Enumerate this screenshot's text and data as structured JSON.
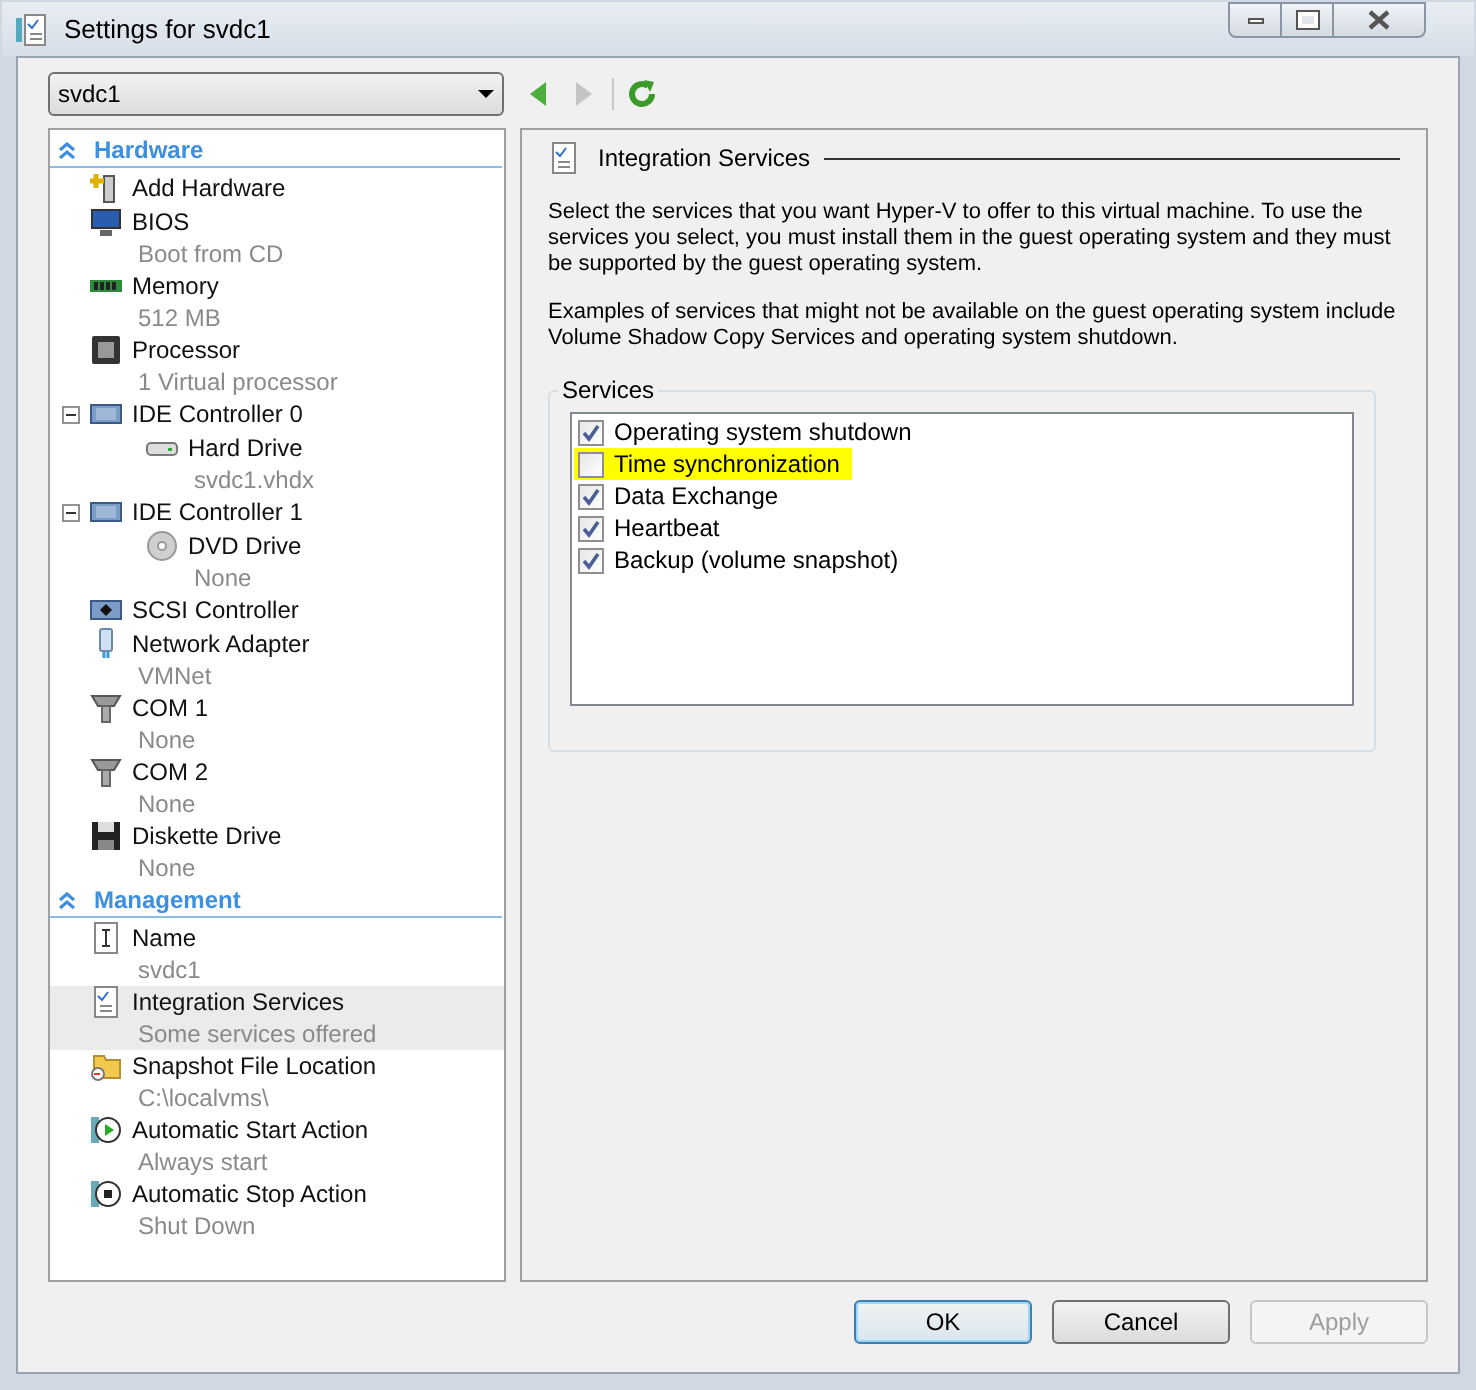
{
  "window": {
    "title": "Settings for svdc1"
  },
  "vm_selector": {
    "value": "svdc1"
  },
  "navigation": {
    "back_disabled": false,
    "forward_disabled": true
  },
  "sections": [
    {
      "title": "Hardware",
      "items": [
        {
          "kind": "add",
          "label": "Add Hardware",
          "selected": false
        },
        {
          "kind": "bios",
          "label": "BIOS",
          "detail": "Boot from CD",
          "selected": false
        },
        {
          "kind": "memory",
          "label": "Memory",
          "detail": "512 MB",
          "selected": false
        },
        {
          "kind": "processor",
          "label": "Processor",
          "detail": "1 Virtual processor",
          "selected": false
        },
        {
          "kind": "ide",
          "label": "IDE Controller 0",
          "selected": false,
          "expanded": true,
          "children": [
            {
              "kind": "harddrive",
              "label": "Hard Drive",
              "detail": "svdc1.vhdx",
              "selected": false
            }
          ]
        },
        {
          "kind": "ide",
          "label": "IDE Controller 1",
          "selected": false,
          "expanded": true,
          "children": [
            {
              "kind": "dvd",
              "label": "DVD Drive",
              "detail": "None",
              "selected": false
            }
          ]
        },
        {
          "kind": "scsi",
          "label": "SCSI Controller",
          "selected": false
        },
        {
          "kind": "network",
          "label": "Network Adapter",
          "detail": "VMNet",
          "selected": false
        },
        {
          "kind": "com",
          "label": "COM 1",
          "detail": "None",
          "selected": false
        },
        {
          "kind": "com",
          "label": "COM 2",
          "detail": "None",
          "selected": false
        },
        {
          "kind": "diskette",
          "label": "Diskette Drive",
          "detail": "None",
          "selected": false
        }
      ]
    },
    {
      "title": "Management",
      "items": [
        {
          "kind": "name",
          "label": "Name",
          "detail": "svdc1",
          "selected": false
        },
        {
          "kind": "integration",
          "label": "Integration Services",
          "detail": "Some services offered",
          "selected": true
        },
        {
          "kind": "snapshot",
          "label": "Snapshot File Location",
          "detail": "C:\\localvms\\",
          "selected": false
        },
        {
          "kind": "start",
          "label": "Automatic Start Action",
          "detail": "Always start",
          "selected": false
        },
        {
          "kind": "stop",
          "label": "Automatic Stop Action",
          "detail": "Shut Down",
          "selected": false
        }
      ]
    }
  ],
  "panel": {
    "title": "Integration Services",
    "paragraphs": [
      "Select the services that you want Hyper-V to offer to this virtual machine. To use the services you select, you must install them in the guest operating system and they must be supported by the guest operating system.",
      "Examples of services that might not be available on the guest operating system include Volume Shadow Copy Services and operating system shutdown."
    ],
    "group_title": "Services",
    "services": [
      {
        "label": "Operating system shutdown",
        "checked": true,
        "highlighted": false
      },
      {
        "label": "Time synchronization",
        "checked": false,
        "highlighted": true
      },
      {
        "label": "Data Exchange",
        "checked": true,
        "highlighted": false
      },
      {
        "label": "Heartbeat",
        "checked": true,
        "highlighted": false
      },
      {
        "label": "Backup (volume snapshot)",
        "checked": true,
        "highlighted": false
      }
    ]
  },
  "buttons": [
    {
      "label": "OK",
      "kind": "default",
      "disabled": false
    },
    {
      "label": "Cancel",
      "kind": "normal",
      "disabled": false
    },
    {
      "label": "Apply",
      "kind": "normal",
      "disabled": true
    }
  ]
}
